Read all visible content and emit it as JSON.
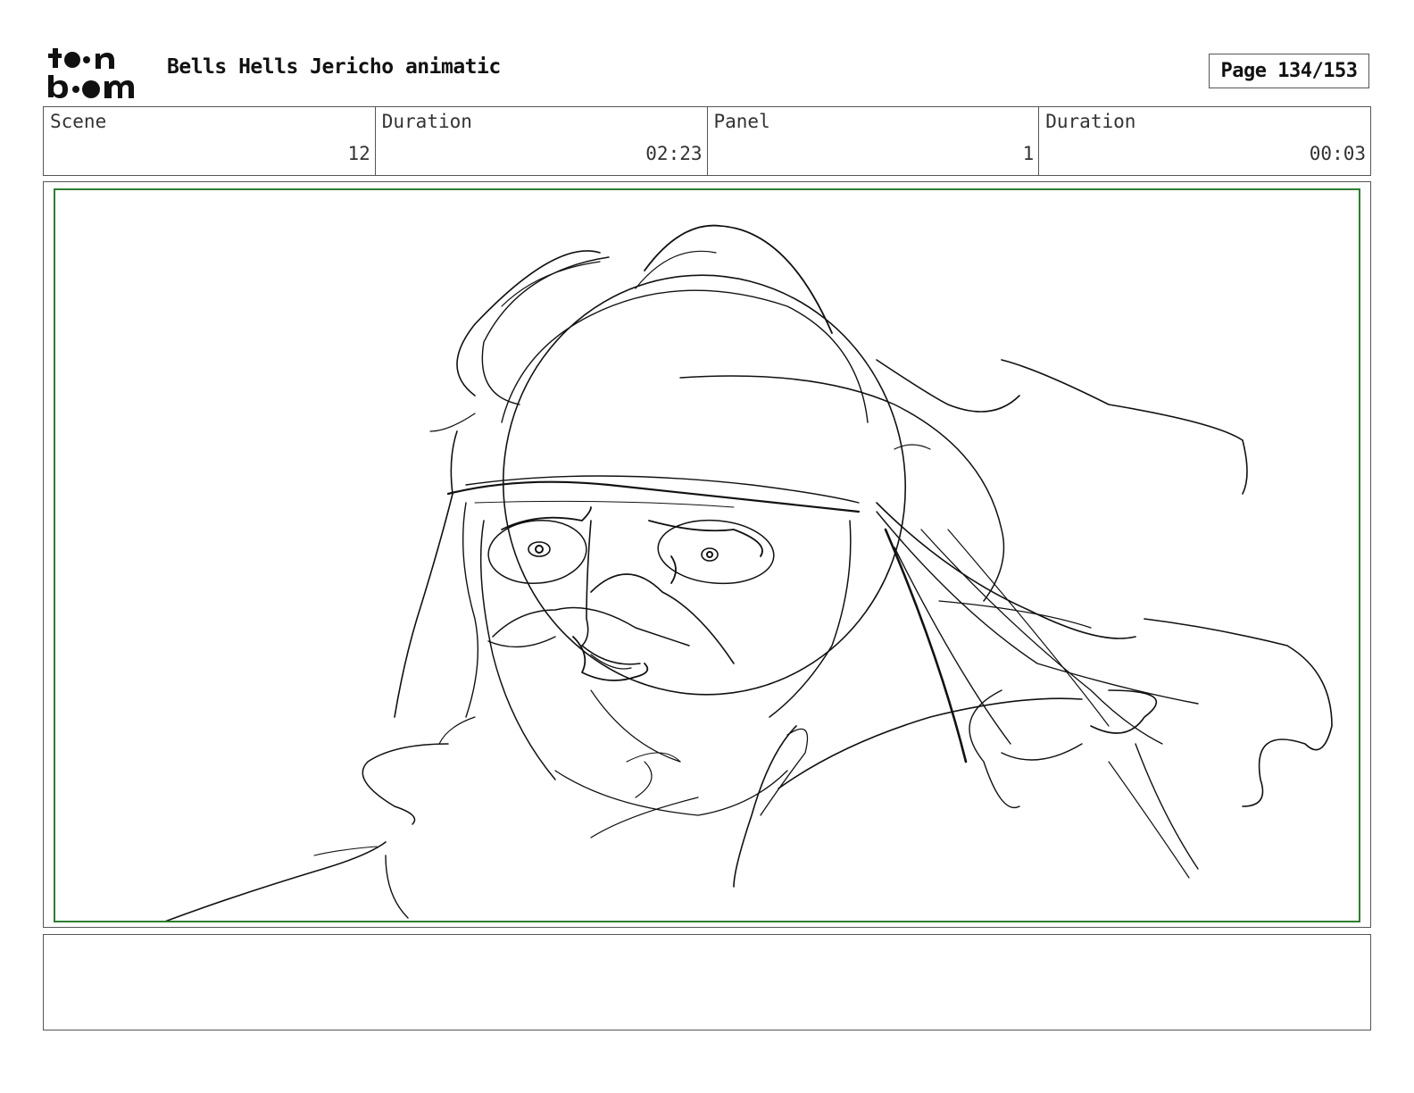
{
  "header": {
    "logo_text": "toon boom",
    "title": "Bells Hells Jericho animatic",
    "page": "Page 134/153"
  },
  "info": [
    {
      "label": "Scene",
      "value": "12"
    },
    {
      "label": "Duration",
      "value": "02:23"
    },
    {
      "label": "Panel",
      "value": "1"
    },
    {
      "label": "Duration",
      "value": "00:03"
    }
  ],
  "panel": {
    "frame_color": "#2e7d32",
    "content": "rough pencil sketch of a character with long hair, round glasses and a mustache"
  },
  "notes": {
    "text": ""
  }
}
